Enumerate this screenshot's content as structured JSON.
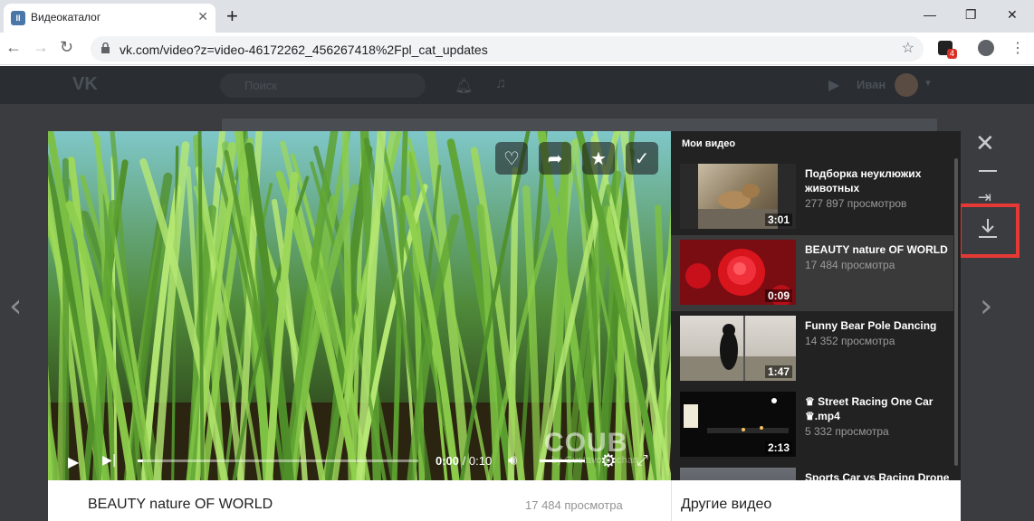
{
  "browser": {
    "tab_title": "Видеокаталог",
    "tab_favicon": "II",
    "url": "vk.com/video?z=video-46172262_456267418%2Fpl_cat_updates",
    "extension_badge": "4"
  },
  "vk": {
    "logo": "VK",
    "search_placeholder": "Поиск",
    "user_name": "Иван"
  },
  "player": {
    "watermark": "COUB",
    "watermark_sub": "by Gustavo Bochan",
    "time_current": "0:00",
    "time_total": "/ 0:10",
    "progress": 0.02
  },
  "playlist": {
    "title": "Мои видео",
    "items": [
      {
        "title": "Подборка неуклюжих животных",
        "views": "277 897 просмотров",
        "duration": "3:01"
      },
      {
        "title": "BEAUTY nature OF WORLD",
        "views": "17 484 просмотра",
        "duration": "0:09"
      },
      {
        "title": "Funny Bear Pole Dancing",
        "views": "14 352 просмотра",
        "duration": "1:47"
      },
      {
        "title": "♛ Street Racing One Car ♛.mp4",
        "views": "5 332 просмотра",
        "duration": "2:13"
      },
      {
        "title": "Sports Car vs Racing Drone",
        "views": "",
        "duration": ""
      }
    ]
  },
  "info": {
    "title": "BEAUTY nature OF WORLD",
    "views": "17 484 просмотра",
    "other_videos": "Другие видео"
  },
  "colors": {
    "highlight": "#e53935",
    "vk_blue": "#4a76a8"
  }
}
